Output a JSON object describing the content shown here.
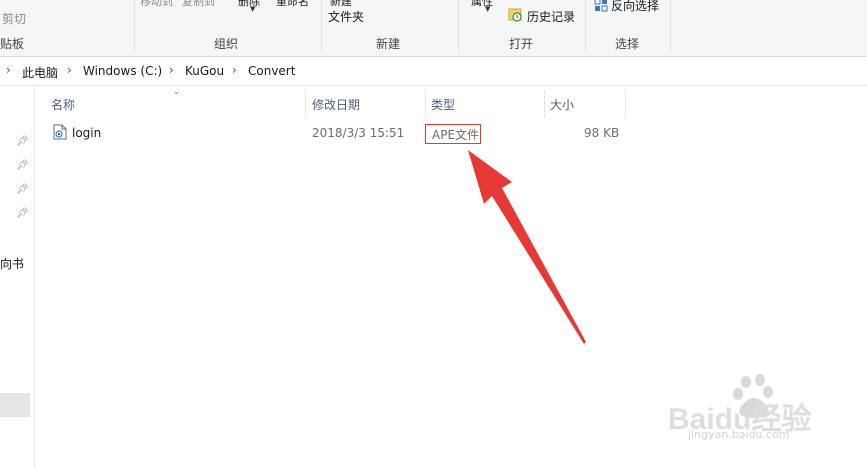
{
  "ribbon": {
    "clipboard": {
      "cut": "剪切",
      "group": "贴板"
    },
    "organize": {
      "move_to": "移动到",
      "copy_to": "复制到",
      "delete": "删除",
      "rename": "重命名",
      "group": "组织"
    },
    "new": {
      "new_folder_line1": "新建",
      "new_folder_line2": "文件夹",
      "group": "新建"
    },
    "open": {
      "properties": "属性",
      "history": "历史记录",
      "group": "打开"
    },
    "select": {
      "invert": "反向选择",
      "group": "选择"
    }
  },
  "address": {
    "path": [
      "此电脑",
      "Windows (C:)",
      "KuGou",
      "Convert"
    ]
  },
  "nav": {
    "partial_item": "向书"
  },
  "columns": {
    "name": "名称",
    "modified": "修改日期",
    "type": "类型",
    "size": "大小"
  },
  "files": [
    {
      "name": "login",
      "modified": "2018/3/3 15:51",
      "type": "APE文件",
      "size": "98 KB"
    }
  ],
  "watermark": {
    "brand": "Baidu经验",
    "url": "jingyan.baidu.com"
  },
  "colors": {
    "annotation_red": "#e53935",
    "header_text": "#4d6082",
    "ribbon_bg": "#f5f6f7"
  }
}
